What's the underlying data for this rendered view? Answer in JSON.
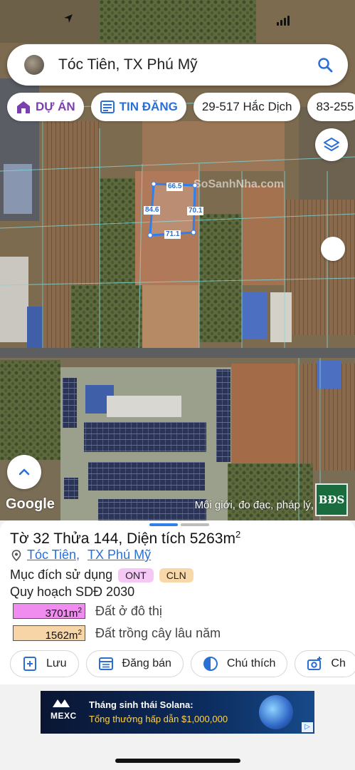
{
  "search": {
    "query": "Tóc Tiên, TX Phú Mỹ",
    "icon": "search-icon"
  },
  "chips": [
    {
      "label": "DỰ ÁN",
      "icon": "project-house-icon",
      "color": "#7b3fb0"
    },
    {
      "label": "TIN ĐĂNG",
      "icon": "listing-icon",
      "color": "#2a6fd6"
    },
    {
      "label": "29-517 Hắc Dịch"
    },
    {
      "label": "83-255"
    }
  ],
  "plot": {
    "top": "66.5",
    "left": "84.6",
    "right": "70.1",
    "bottom": "71.1"
  },
  "map": {
    "watermark": "SoSanhNha.com",
    "google": "Google",
    "disclaimer": "Môi giới, đo đạc, pháp lý,",
    "logo": "BĐS"
  },
  "panel": {
    "title_prefix": "Tờ 32 Thửa 144, Diện tích 5263m",
    "title_sup": "2",
    "location_1": "Tóc Tiên",
    "location_2": "TX Phú Mỹ",
    "purpose_label": "Mục đích sử dụng",
    "badges": [
      {
        "label": "ONT",
        "bg": "#f5c8f5"
      },
      {
        "label": "CLN",
        "bg": "#f8d7a8"
      }
    ],
    "plan_title": "Quy hoạch SDĐ 2030",
    "plan_rows": [
      {
        "area": "3701m",
        "sup": "2",
        "desc": "Đất ở đô thị",
        "color": "#f08cf0"
      },
      {
        "area": "1562m",
        "sup": "2",
        "desc": "Đất trồng cây lâu năm",
        "color": "#f8d5a6"
      }
    ]
  },
  "actions": [
    {
      "label": "Lưu",
      "icon": "bookmark-add-icon"
    },
    {
      "label": "Đăng bán",
      "icon": "calendar-list-icon"
    },
    {
      "label": "Chú thích",
      "icon": "half-circle-icon"
    },
    {
      "label": "Ch",
      "icon": "add-photo-icon"
    }
  ],
  "ad": {
    "brand": "MEXC",
    "line1": "Tháng sinh thái Solana:",
    "line2": "Tổng thưởng hấp dẫn $1,000,000",
    "info": "▷"
  },
  "colors": {
    "accent_blue": "#2a6fd6",
    "handle_blue": "#2f80ed"
  }
}
